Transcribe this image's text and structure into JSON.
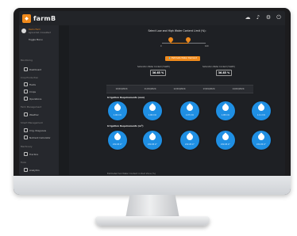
{
  "app": {
    "brand": "farmB"
  },
  "topbar": {
    "icons": [
      "cloud-icon",
      "bell-icon",
      "gear-icon",
      "power-icon"
    ]
  },
  "sidebar": {
    "profile_name": "Demo Farm",
    "profile_sub": "Agronomist / Consultant",
    "toggle_label": "Toggle Menu",
    "sections": [
      {
        "label": "Monitoring",
        "items": [
          "Dashboard"
        ]
      },
      {
        "label": "Crop Production",
        "items": [
          "Fields",
          "Crops",
          "Operations"
        ]
      },
      {
        "label": "Farm Management",
        "items": [
          "Weather"
        ]
      },
      {
        "label": "Smart Management",
        "items": [
          "Irrig. Diagnosis",
          "Nutrient Calculator"
        ]
      },
      {
        "label": "Machinery",
        "items": [
          "Tractors"
        ]
      },
      {
        "label": "Tools",
        "items": [
          "Analytics"
        ]
      }
    ]
  },
  "main": {
    "water_title": "Select Low and High Water Content Limit (%):",
    "slider": {
      "low_value": "20",
      "high_value": "60",
      "min_label": "0",
      "max_label": "100",
      "low_fraction": 0.2,
      "high_fraction": 0.6
    },
    "estimate_button": "Estimate Water Demand",
    "stats": [
      {
        "label": "Saturation Water Content (%SWC)",
        "value": "36.65 %"
      },
      {
        "label": "Saturation Water Content (%SWC)",
        "value": "36.85 %"
      }
    ],
    "dates": [
      "10/01/2024",
      "11/01/2024",
      "12/01/2024",
      "13/01/2024",
      "14/01/2024"
    ],
    "irrigation_mm_label": "Irrigation Requirements (mm)",
    "irrigation_mm_values": [
      "1.06 mm",
      "1.06 mm",
      "1.07 mm",
      "1.08 mm",
      "1.11 mm"
    ],
    "irrigation_m3_label": "Irrigation Requirements (m³)",
    "irrigation_m3_values": [
      "222.26 m³",
      "222.26 m³",
      "222.26 m³",
      "222.26 m³",
      "222.26 m³"
    ],
    "footer_text": "Estimated Soil Water Content in Root Zone (%)"
  },
  "colors": {
    "accent": "#f08a1c",
    "drop": "#1f8fe3",
    "background": "#1e2024"
  }
}
